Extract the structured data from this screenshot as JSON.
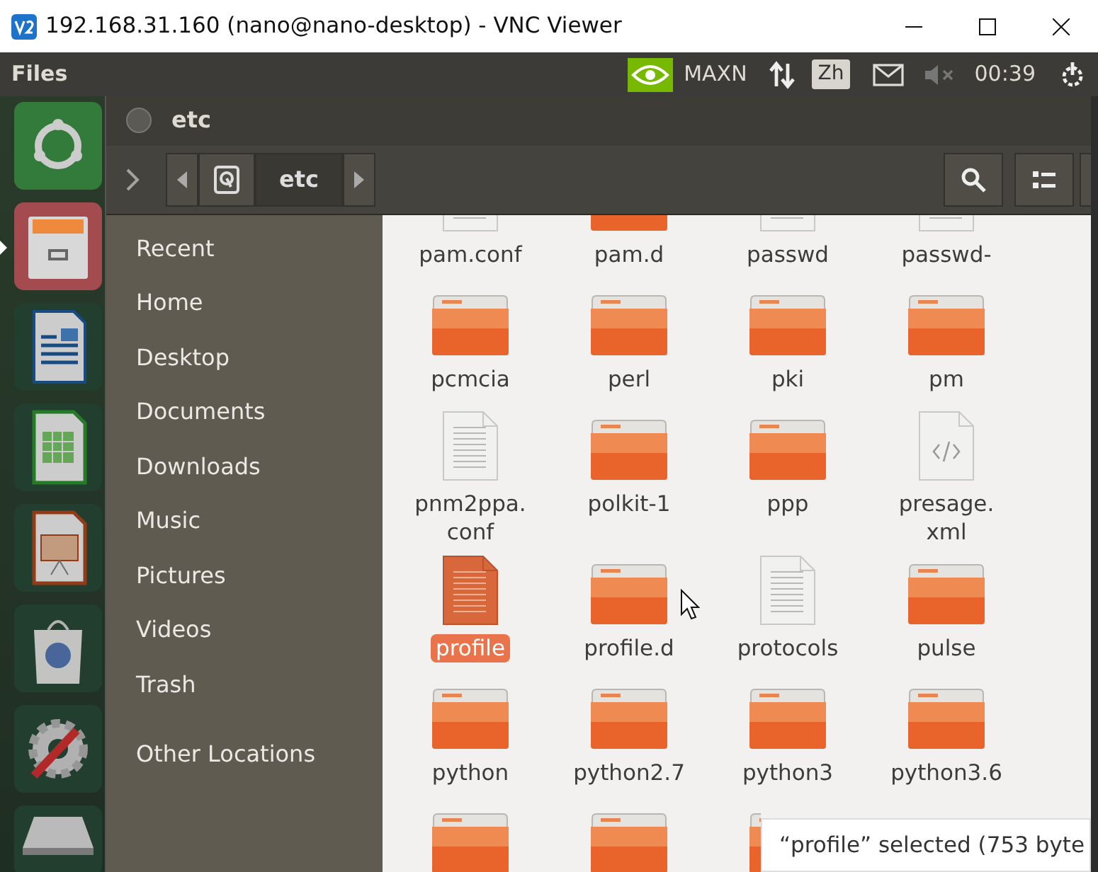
{
  "window": {
    "title": "192.168.31.160 (nano@nano-desktop) - VNC Viewer"
  },
  "top_panel": {
    "app_name": "Files",
    "power_mode": "MAXN",
    "language": "Zh",
    "clock": "00:39"
  },
  "launcher": [
    {
      "kind": "dash",
      "active": false
    },
    {
      "kind": "files",
      "active": true
    },
    {
      "kind": "writer",
      "active": false
    },
    {
      "kind": "calc",
      "active": false
    },
    {
      "kind": "impress",
      "active": false
    },
    {
      "kind": "software",
      "active": false
    },
    {
      "kind": "settings",
      "active": false
    },
    {
      "kind": "drive",
      "active": false
    }
  ],
  "file_window": {
    "title": "etc",
    "path_bar": [
      {
        "kind": "drive",
        "selected": false
      },
      {
        "kind": "folder",
        "label": "etc",
        "selected": true
      }
    ]
  },
  "sidebar": {
    "places": [
      "Recent",
      "Home",
      "Desktop",
      "Documents",
      "Downloads",
      "Music",
      "Pictures",
      "Videos",
      "Trash"
    ],
    "other_locations": "Other Locations"
  },
  "files": [
    {
      "name": "pam.conf",
      "kind": "document",
      "selected": false
    },
    {
      "name": "pam.d",
      "kind": "folder",
      "selected": false
    },
    {
      "name": "passwd",
      "kind": "document",
      "selected": false
    },
    {
      "name": "passwd-",
      "kind": "document",
      "selected": false
    },
    {
      "name": "pcmcia",
      "kind": "folder",
      "selected": false
    },
    {
      "name": "perl",
      "kind": "folder",
      "selected": false
    },
    {
      "name": "pki",
      "kind": "folder",
      "selected": false
    },
    {
      "name": "pm",
      "kind": "folder",
      "selected": false
    },
    {
      "name": "pnm2ppa.\nconf",
      "kind": "document",
      "selected": false
    },
    {
      "name": "polkit-1",
      "kind": "folder",
      "selected": false
    },
    {
      "name": "ppp",
      "kind": "folder",
      "selected": false
    },
    {
      "name": "presage.\nxml",
      "kind": "xml",
      "selected": false
    },
    {
      "name": "profile",
      "kind": "document",
      "selected": true
    },
    {
      "name": "profile.d",
      "kind": "folder",
      "selected": false
    },
    {
      "name": "protocols",
      "kind": "document",
      "selected": false
    },
    {
      "name": "pulse",
      "kind": "folder",
      "selected": false
    },
    {
      "name": "python",
      "kind": "folder",
      "selected": false
    },
    {
      "name": "python2.7",
      "kind": "folder",
      "selected": false
    },
    {
      "name": "python3",
      "kind": "folder",
      "selected": false
    },
    {
      "name": "python3.6",
      "kind": "folder",
      "selected": false
    },
    {
      "kind": "folder"
    },
    {
      "kind": "folder"
    },
    {
      "kind": "folder"
    }
  ],
  "status": "“profile” selected (753 byte"
}
